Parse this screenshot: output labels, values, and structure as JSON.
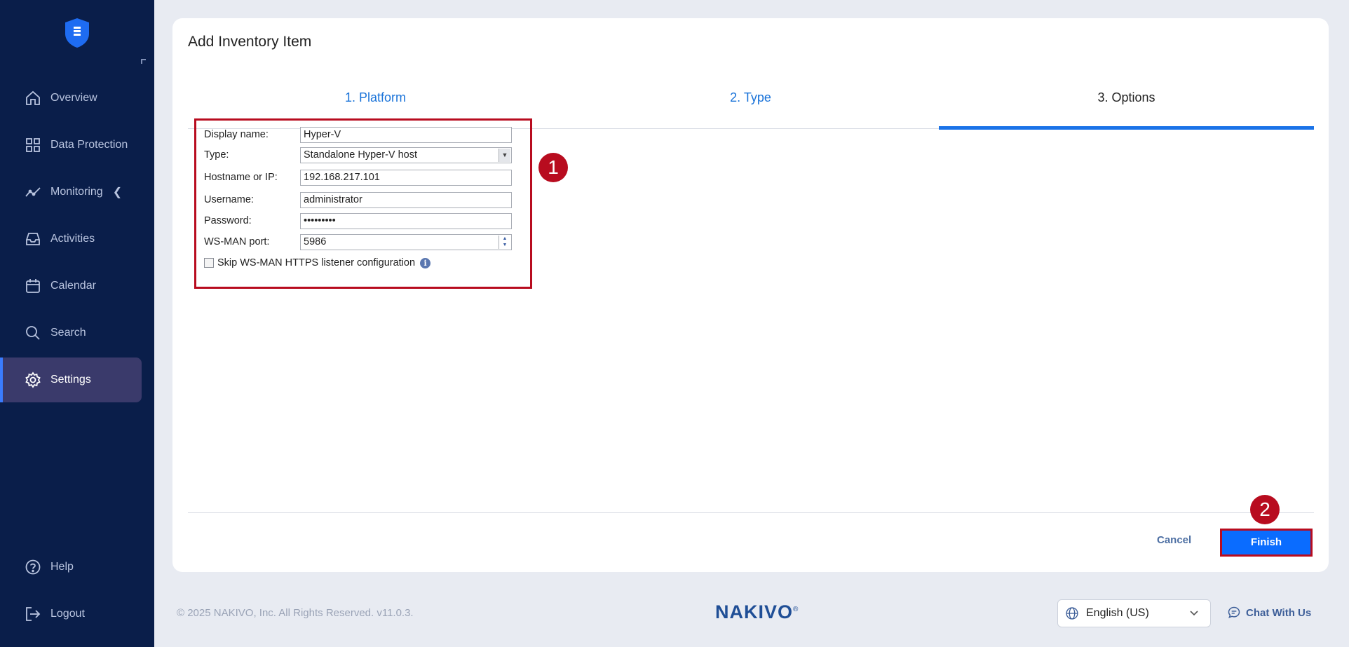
{
  "sidebar": {
    "items": [
      {
        "label": "Overview",
        "icon": "home-icon"
      },
      {
        "label": "Data Protection",
        "icon": "grid-icon"
      },
      {
        "label": "Monitoring",
        "icon": "chart-line-icon"
      },
      {
        "label": "Activities",
        "icon": "inbox-icon"
      },
      {
        "label": "Calendar",
        "icon": "calendar-icon"
      },
      {
        "label": "Search",
        "icon": "search-icon"
      },
      {
        "label": "Settings",
        "icon": "gear-icon",
        "active": true
      }
    ],
    "bottom_items": [
      {
        "label": "Help",
        "icon": "help-icon"
      },
      {
        "label": "Logout",
        "icon": "logout-icon"
      }
    ]
  },
  "page": {
    "title": "Add Inventory Item",
    "tabs": [
      {
        "label": "1. Platform"
      },
      {
        "label": "2. Type"
      },
      {
        "label": "3. Options",
        "active": true
      }
    ]
  },
  "form": {
    "display_name_label": "Display name:",
    "display_name_value": "Hyper-V",
    "type_label": "Type:",
    "type_value": "Standalone Hyper-V host",
    "hostname_label": "Hostname or IP:",
    "hostname_value": "192.168.217.101",
    "username_label": "Username:",
    "username_value": "administrator",
    "password_label": "Password:",
    "password_value": "•••••••••",
    "wsman_port_label": "WS-MAN port:",
    "wsman_port_value": "5986",
    "skip_label": "Skip WS-MAN HTTPS listener configuration",
    "skip_checked": false
  },
  "annotations": {
    "badge1": "1",
    "badge2": "2"
  },
  "actions": {
    "cancel_label": "Cancel",
    "finish_label": "Finish"
  },
  "footer": {
    "copyright": "© 2025 NAKIVO, Inc. All Rights Reserved. v11.0.3.",
    "brand": "NAKIVO",
    "brand_mark": "®",
    "language": "English (US)",
    "chat_label": "Chat With Us"
  },
  "colors": {
    "sidebar_bg": "#0a1e4a",
    "accent": "#1a73e8",
    "annotation_red": "#b80c1f",
    "finish_bg": "#0a6cff"
  }
}
